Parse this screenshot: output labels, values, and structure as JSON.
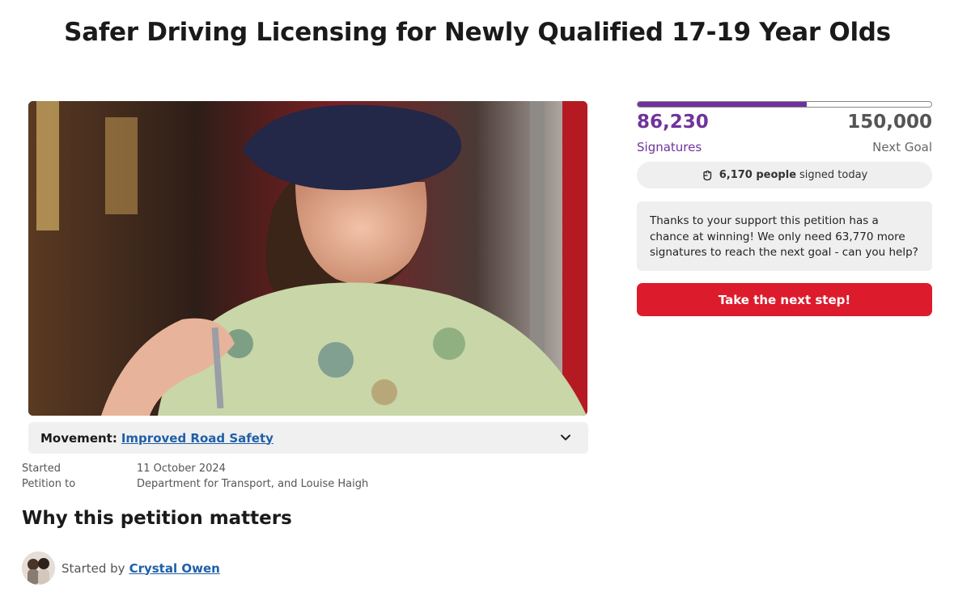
{
  "title": "Safer Driving Licensing for Newly Qualified 17-19 Year Olds",
  "movement": {
    "label": "Movement:",
    "link": "Improved Road Safety"
  },
  "meta": [
    {
      "key": "Started",
      "value": "11 October 2024"
    },
    {
      "key": "Petition to",
      "value": "Department for Transport, and Louise Haigh"
    }
  ],
  "section_title": "Why this petition matters",
  "starter": {
    "prefix": "Started by",
    "name": "Crystal Owen"
  },
  "progress": {
    "signatures": 86230,
    "goal": 150000,
    "fraction": 0.575
  },
  "signatures": {
    "count": "86,230",
    "label": "Signatures"
  },
  "goal": {
    "count": "150,000",
    "label": "Next Goal"
  },
  "today": {
    "count": "6,170 people",
    "suffix": "signed today"
  },
  "support_text": "Thanks to your support this petition has a chance at winning! We only need 63,770 more signatures to reach the next goal - can you help?",
  "cta_label": "Take the next step!",
  "colors": {
    "accent": "#70339c",
    "cta": "#dc1b2c",
    "link": "#1f5fa8"
  },
  "icons": {
    "today": "fist-icon",
    "movement_toggle": "chevron-down-icon"
  }
}
